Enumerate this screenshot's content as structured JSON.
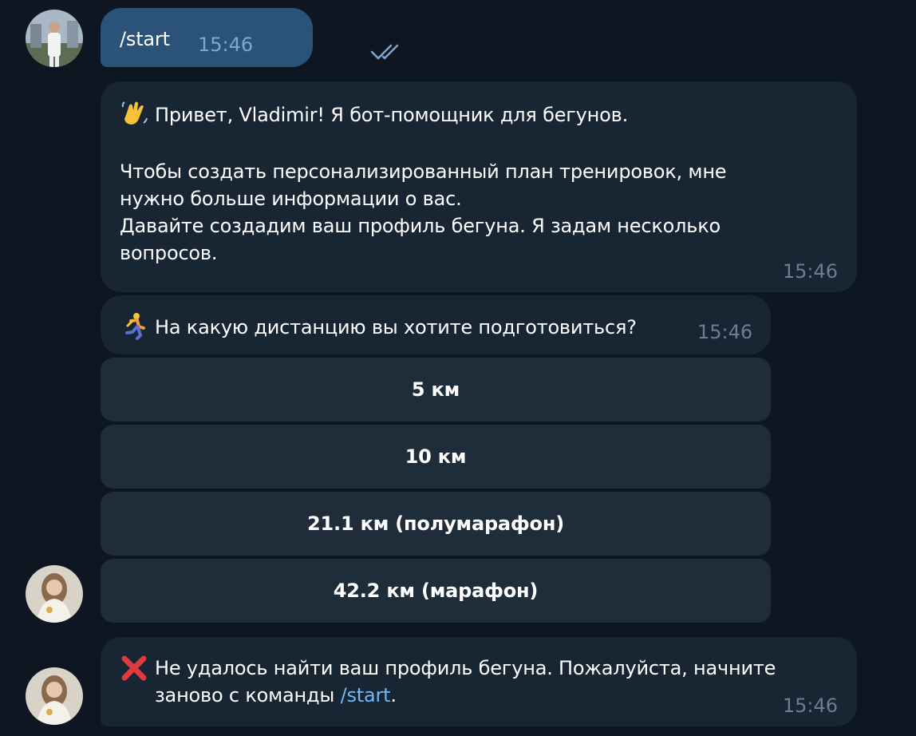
{
  "messages": {
    "user_start": {
      "text": "/start",
      "time": "15:46",
      "status_icon": "double-check-icon"
    },
    "greeting": {
      "emoji": "waving-hand",
      "line1": "Привет, Vladimir! Я бот-помощник для бегунов.",
      "body": "Чтобы создать персонализированный план тренировок, мне\nнужно больше информации о вас.\nДавайте создадим ваш профиль бегуна. Я задам несколько\nвопросов.",
      "time": "15:46"
    },
    "distance_question": {
      "emoji": "person-running",
      "text": "На какую дистанцию вы хотите подготовиться?",
      "time": "15:46"
    },
    "distance_options": [
      {
        "label": "5 км"
      },
      {
        "label": "10 км"
      },
      {
        "label": "21.1 км (полумарафон)"
      },
      {
        "label": "42.2 км (марафон)"
      }
    ],
    "error": {
      "emoji": "cross-mark",
      "text_part1": "Не удалось найти ваш профиль бегуна. Пожалуйста, начните\nзаново с команды ",
      "command": "/start",
      "text_part2": ".",
      "time": "15:46"
    }
  },
  "colors": {
    "background": "#0e1621",
    "incoming_bubble": "#182533",
    "outgoing_bubble": "#2b5278",
    "keyboard_button": "#1f2c3a",
    "link": "#71b9f4",
    "timestamp": "#6d7f8f"
  }
}
